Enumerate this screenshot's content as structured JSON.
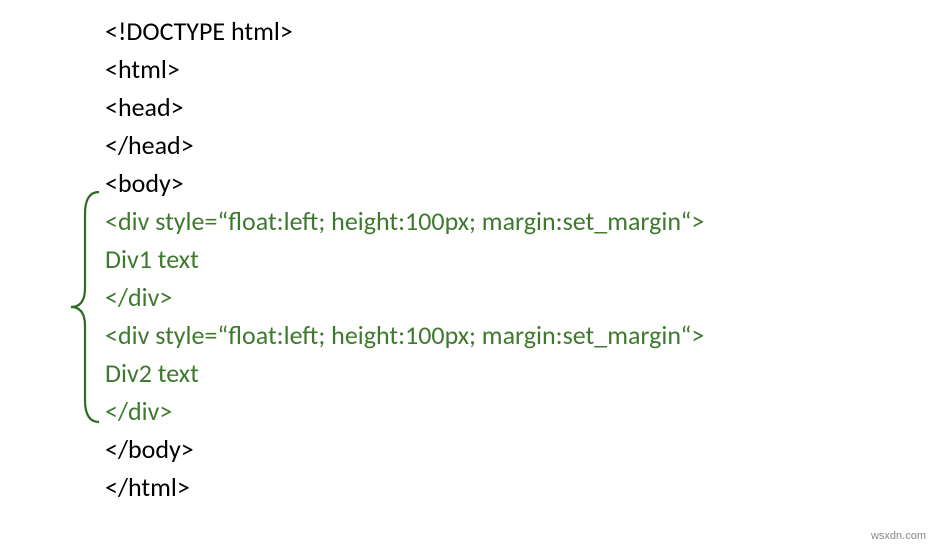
{
  "code": {
    "l1": "<!DOCTYPE html>",
    "l2": "<html>",
    "l3": "<head>",
    "l4": "</head>",
    "l5": "<body>",
    "l6": "<div style=“float:left; height:100px; margin:set_margin“>",
    "l7": "Div1 text",
    "l8": "</div>",
    "l9": "<div style=“float:left; height:100px; margin:set_margin“>",
    "l10": "Div2 text",
    "l11": "</div>",
    "l12": "</body>",
    "l13": "</html>"
  },
  "watermark": "wsxdn.com"
}
